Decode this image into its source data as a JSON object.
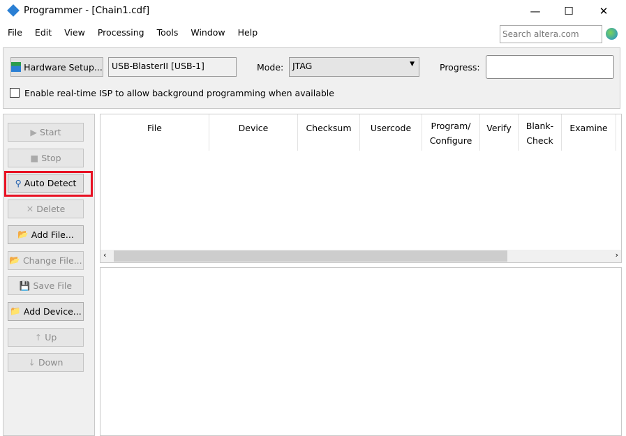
{
  "window": {
    "title": "Programmer - [Chain1.cdf]",
    "minimize": "—",
    "maximize": "☐",
    "close": "✕"
  },
  "menu": [
    "File",
    "Edit",
    "View",
    "Processing",
    "Tools",
    "Window",
    "Help"
  ],
  "search": {
    "placeholder": "Search altera.com"
  },
  "toolbar": {
    "hardware_setup": "Hardware Setup...",
    "hardware": "USB-BlasterII [USB-1]",
    "mode_label": "Mode:",
    "mode": "JTAG",
    "progress_label": "Progress:",
    "isp_label": "Enable real-time ISP to allow background programming when available",
    "isp_checked": false
  },
  "buttons": [
    {
      "label": "Start",
      "enabled": false
    },
    {
      "label": "Stop",
      "enabled": false
    },
    {
      "label": "Auto Detect",
      "enabled": true,
      "highlighted": true
    },
    {
      "label": "Delete",
      "enabled": false
    },
    {
      "label": "Add File...",
      "enabled": true
    },
    {
      "label": "Change File...",
      "enabled": false
    },
    {
      "label": "Save File",
      "enabled": false
    },
    {
      "label": "Add Device...",
      "enabled": true
    },
    {
      "label": "Up",
      "enabled": false
    },
    {
      "label": "Down",
      "enabled": false
    }
  ],
  "columns": [
    "File",
    "Device",
    "Checksum",
    "Usercode",
    "Program/ Configure",
    "Verify",
    "Blank- Check",
    "Examine"
  ],
  "colors": {
    "highlight": "#e81123"
  }
}
